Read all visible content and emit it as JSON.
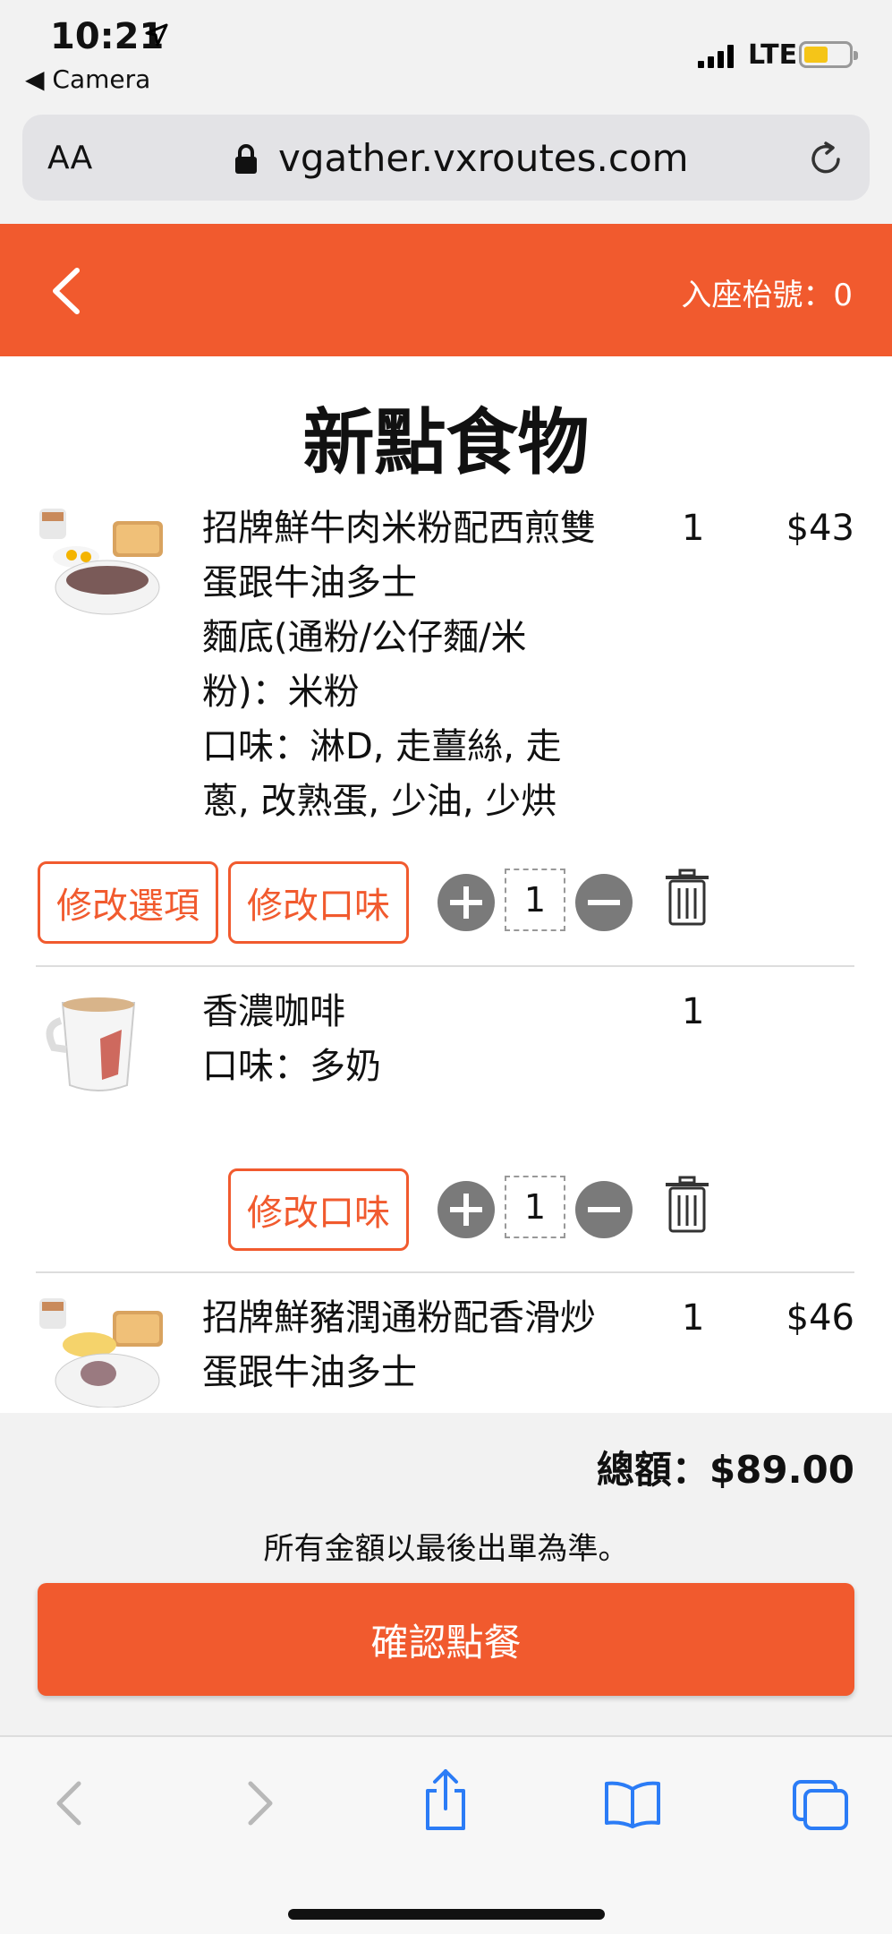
{
  "status_bar": {
    "time": "10:21",
    "back_app": "◀ Camera",
    "network": "LTE"
  },
  "browser": {
    "text_size": "AA",
    "url": "vgather.vxroutes.com"
  },
  "header": {
    "seat_label": "入座枱號：0"
  },
  "page_title": "新點食物",
  "items": [
    {
      "name": "招牌鮮牛肉米粉配西煎雙蛋跟牛油多士",
      "options": "麵底(通粉/公仔麵/米粉)：米粉",
      "flavor": "口味：淋D, 走薑絲, 走蔥, 改熟蛋, 少油, 少烘",
      "qty": "1",
      "price": "$43",
      "edit_options": "修改選項",
      "edit_flavor": "修改口味",
      "stepper_value": "1"
    },
    {
      "name": "香濃咖啡",
      "flavor": "口味：多奶",
      "qty": "1",
      "price": "",
      "edit_flavor": "修改口味",
      "stepper_value": "1"
    },
    {
      "name": "招牌鮮豬潤通粉配香滑炒蛋跟牛油多士",
      "qty": "1",
      "price": "$46"
    }
  ],
  "footer": {
    "total": "總額：$89.00",
    "disclaimer": "所有金額以最後出單為準。",
    "confirm": "確認點餐"
  },
  "colors": {
    "accent": "#f15a2e",
    "control_gray": "#7a7a7a",
    "safari_blue": "#2b7cf6"
  }
}
